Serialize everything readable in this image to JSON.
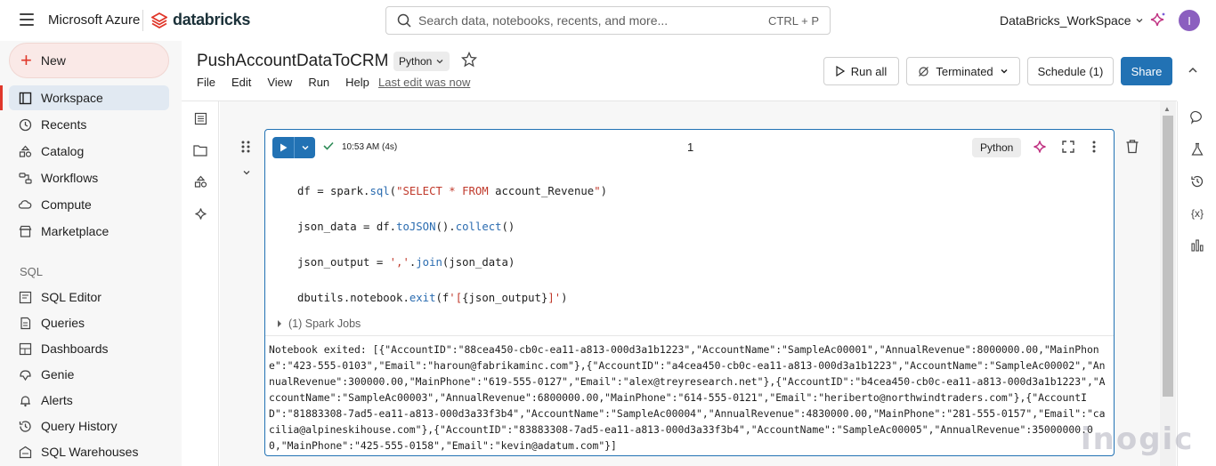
{
  "topbar": {
    "azure_label": "Microsoft Azure",
    "brand": "databricks",
    "search_placeholder": "Search data, notebooks, recents, and more...",
    "search_shortcut": "CTRL + P",
    "workspace": "DataBricks_WorkSpace",
    "avatar_initial": "I"
  },
  "sidebar": {
    "new_label": "New",
    "items": [
      {
        "label": "Workspace",
        "icon": "workspace-icon"
      },
      {
        "label": "Recents",
        "icon": "clock-icon"
      },
      {
        "label": "Catalog",
        "icon": "catalog-icon"
      },
      {
        "label": "Workflows",
        "icon": "workflows-icon"
      },
      {
        "label": "Compute",
        "icon": "cloud-icon"
      },
      {
        "label": "Marketplace",
        "icon": "store-icon"
      }
    ],
    "sql_section": "SQL",
    "sql_items": [
      {
        "label": "SQL Editor",
        "icon": "sql-editor-icon"
      },
      {
        "label": "Queries",
        "icon": "queries-icon"
      },
      {
        "label": "Dashboards",
        "icon": "dashboards-icon"
      },
      {
        "label": "Genie",
        "icon": "genie-icon"
      },
      {
        "label": "Alerts",
        "icon": "bell-icon"
      },
      {
        "label": "Query History",
        "icon": "history-icon"
      },
      {
        "label": "SQL Warehouses",
        "icon": "warehouse-icon"
      }
    ]
  },
  "notebook": {
    "title": "PushAccountDataToCRM",
    "language": "Python",
    "menu": [
      "File",
      "Edit",
      "View",
      "Run",
      "Help"
    ],
    "last_edit": "Last edit was now",
    "run_all": "Run all",
    "cluster_status": "Terminated",
    "schedule": "Schedule (1)",
    "share": "Share"
  },
  "cell": {
    "time": "10:53 AM (4s)",
    "number": "1",
    "language": "Python",
    "code": [
      "df = spark.sql(\"SELECT * FROM account_Revenue\")",
      "json_data = df.toJSON().collect()",
      "json_output = ','.join(json_data)",
      "dbutils.notebook.exit(f'[{json_output}]')"
    ],
    "spark_jobs": "(1) Spark Jobs",
    "output": "Notebook exited: [{\"AccountID\":\"88cea450-cb0c-ea11-a813-000d3a1b1223\",\"AccountName\":\"SampleAc00001\",\"AnnualRevenue\":8000000.00,\"MainPhone\":\"423-555-0103\",\"Email\":\"haroun@fabrikaminc.com\"},{\"AccountID\":\"a4cea450-cb0c-ea11-a813-000d3a1b1223\",\"AccountName\":\"SampleAc00002\",\"AnnualRevenue\":300000.00,\"MainPhone\":\"619-555-0127\",\"Email\":\"alex@treyresearch.net\"},{\"AccountID\":\"b4cea450-cb0c-ea11-a813-000d3a1b1223\",\"AccountName\":\"SampleAc00003\",\"AnnualRevenue\":6800000.00,\"MainPhone\":\"614-555-0121\",\"Email\":\"heriberto@northwindtraders.com\"},{\"AccountID\":\"81883308-7ad5-ea11-a813-000d3a33f3b4\",\"AccountName\":\"SampleAc00004\",\"AnnualRevenue\":4830000.00,\"MainPhone\":\"281-555-0157\",\"Email\":\"cacilia@alpineskihouse.com\"},{\"AccountID\":\"83883308-7ad5-ea11-a813-000d3a33f3b4\",\"AccountName\":\"SampleAc00005\",\"AnnualRevenue\":35000000.00,\"MainPhone\":\"425-555-0158\",\"Email\":\"kevin@adatum.com\"}]"
  },
  "watermark": "inogic",
  "colors": {
    "accent": "#2272b4",
    "brand": "#e0372a",
    "active_nav": "#e1e9f2"
  }
}
